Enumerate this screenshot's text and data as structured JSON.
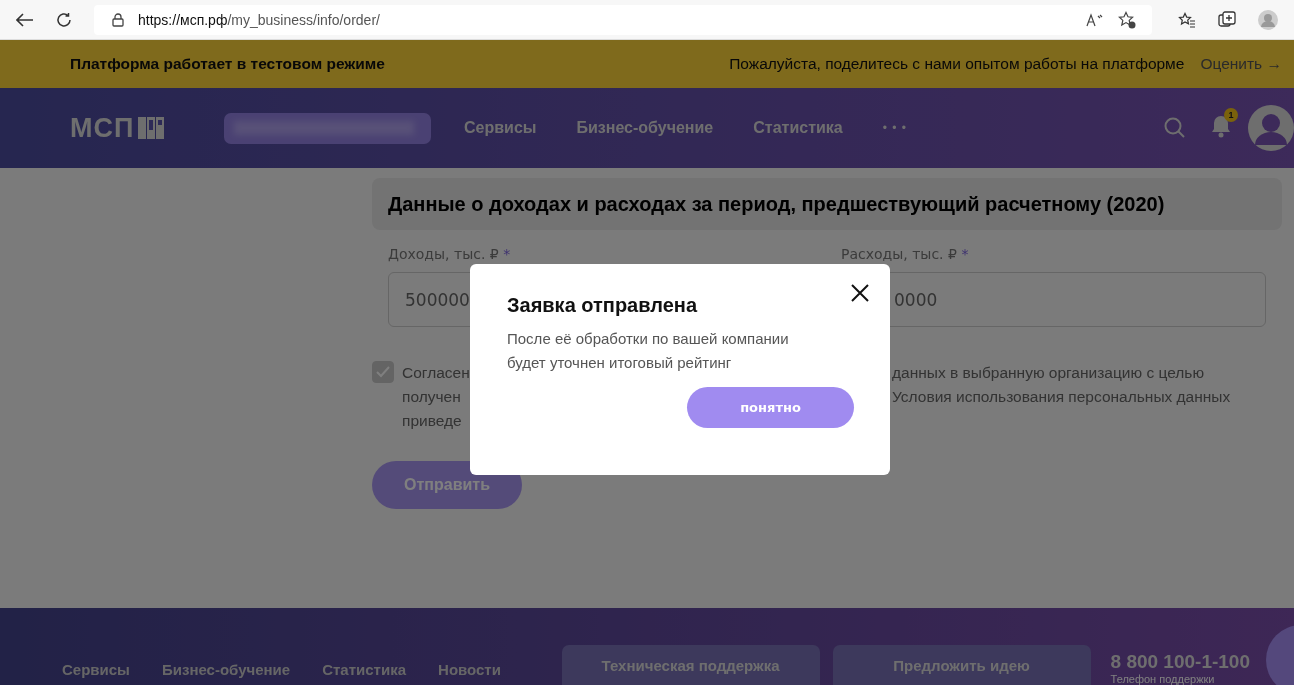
{
  "browser": {
    "url_host": "https://мсп.рф",
    "url_path": "/my_business/info/order/"
  },
  "banner": {
    "text": "Платформа работает в тестовом режиме",
    "prompt": "Пожалуйста, поделитесь с нами опытом работы на платформе",
    "action": "Оценить",
    "arrow": "→"
  },
  "header": {
    "logo": "МСП",
    "nav": [
      "Сервисы",
      "Бизнес-обучение",
      "Статистика"
    ],
    "more": "• • •",
    "notifications": "1"
  },
  "section": {
    "title": "Данные о доходах и расходах за период, предшествующий расчетному (2020)",
    "fields": [
      {
        "label": "Доходы, тыс. ₽",
        "required": "*",
        "value": "500000"
      },
      {
        "label": "Расходы, тыс. ₽",
        "required": "*",
        "value": "0000"
      }
    ],
    "consent": {
      "checked": true,
      "left_lines": [
        "Согласен",
        "получен",
        "приведе"
      ],
      "right_lines": [
        "данных в выбранную организацию с целью",
        "Условия использования персональных данных"
      ]
    },
    "submit": "Отправить"
  },
  "modal": {
    "title": "Заявка отправлена",
    "text": "После её обработки по вашей компании будет уточнен итоговый рейтинг",
    "button": "понятно"
  },
  "footer": {
    "nav": [
      "Сервисы",
      "Бизнес-обучение",
      "Статистика",
      "Новости"
    ],
    "buttons": [
      "Техническая поддержка",
      "Предложить идею"
    ],
    "phone": "8 800 100-1-100",
    "phone_caption": "Телефон поддержки"
  }
}
